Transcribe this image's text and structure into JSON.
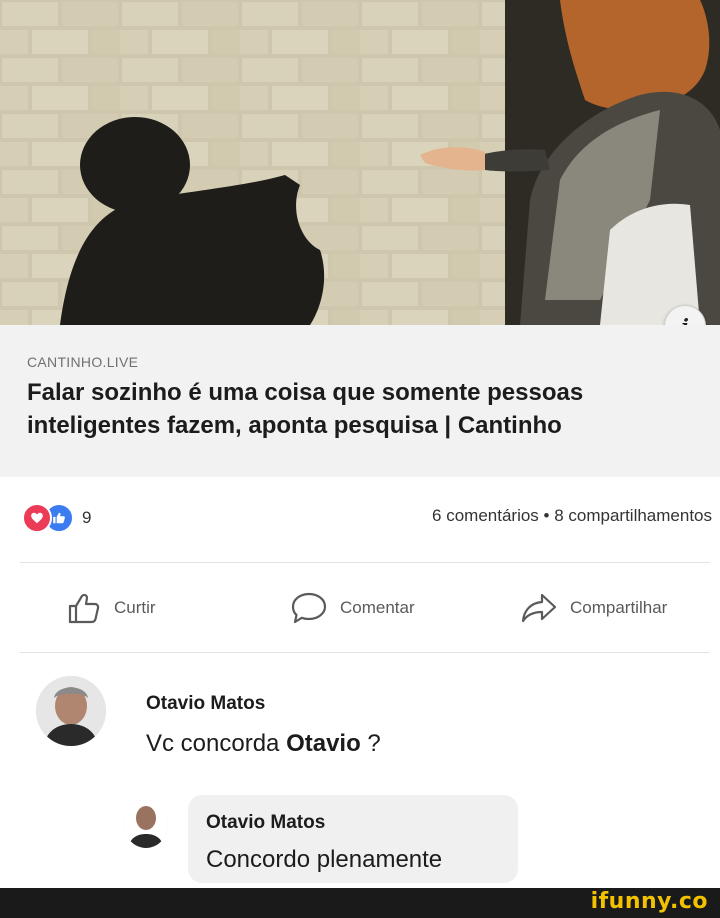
{
  "post": {
    "image_description_icon": "info-icon",
    "link": {
      "source": "CANTINHO.LIVE",
      "title": "Falar sozinho é uma coisa que somente pessoas inteligentes fazem, aponta pesquisa | Cantinho"
    },
    "reactions": {
      "icons": [
        "love-reaction-icon",
        "like-reaction-icon"
      ],
      "count": "9"
    },
    "stats": "6 comentários • 8 compartilhamentos",
    "actions": [
      {
        "label": "Curtir",
        "icon": "thumbs-up-icon"
      },
      {
        "label": "Comentar",
        "icon": "comment-icon"
      },
      {
        "label": "Compartilhar",
        "icon": "share-icon"
      }
    ]
  },
  "comments": [
    {
      "author": "Otavio Matos",
      "text_before": "Vc concorda ",
      "text_bold": "Otavio",
      "text_after": " ?"
    },
    {
      "author": "Otavio Matos",
      "text": "Concordo plenamente"
    }
  ],
  "watermark": "ifunny.co",
  "colors": {
    "love": "#ec3b56",
    "like": "#3b7cf0",
    "watermark": "#f2c200"
  }
}
